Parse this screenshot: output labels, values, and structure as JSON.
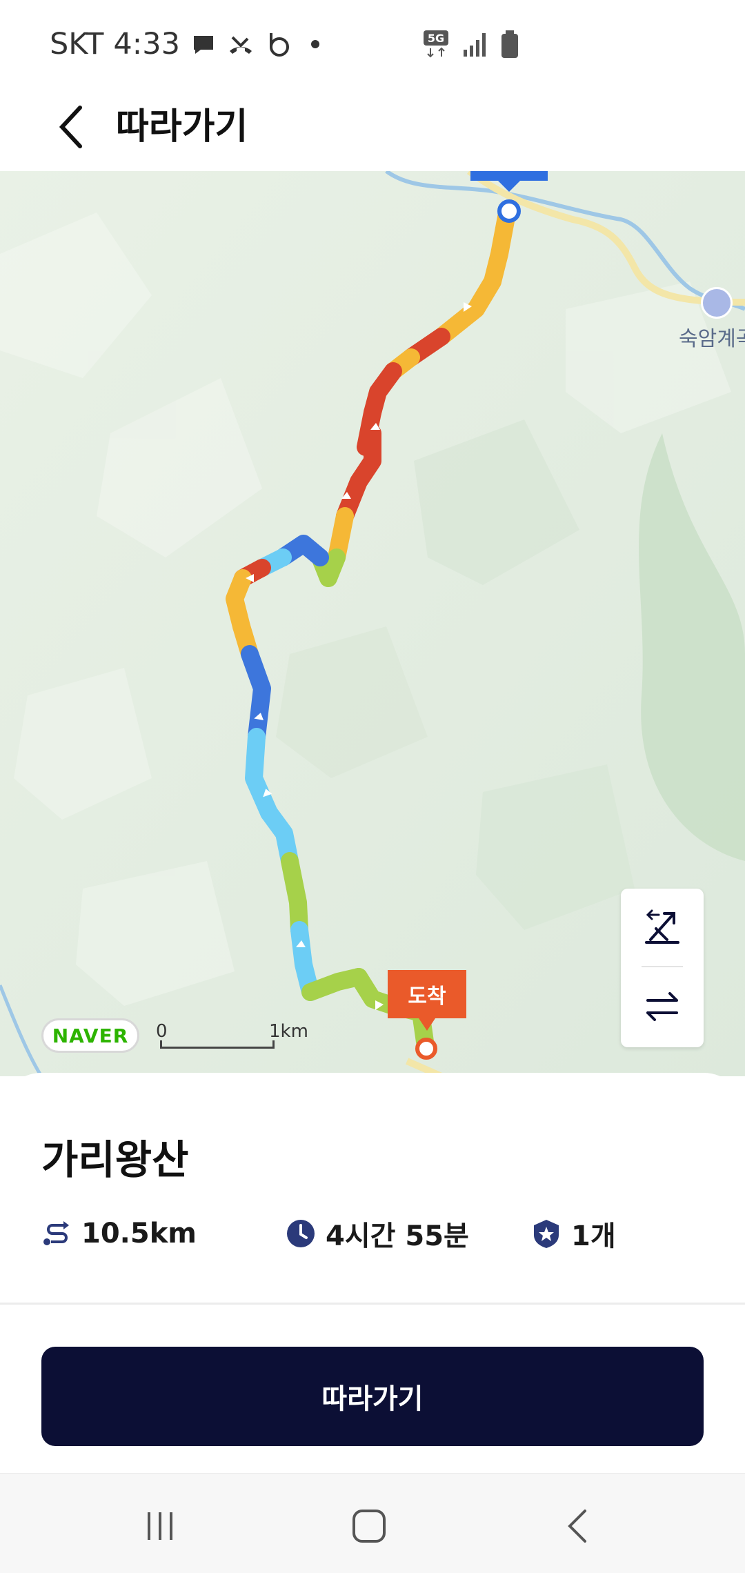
{
  "status_bar": {
    "carrier": "SKT",
    "time": "4:33",
    "network": "5G",
    "icons": [
      "chat-icon",
      "missed-call-icon",
      "b-app-icon",
      "dot-icon",
      "5g-icon",
      "signal-icon",
      "battery-icon"
    ]
  },
  "header": {
    "title": "따라가기",
    "back_icon": "chevron-left-icon"
  },
  "map": {
    "poi_label": "숙암계곡",
    "arrival_label": "도착",
    "naver_logo": "NAVER",
    "scale_zero": "0",
    "scale_distance": "1km",
    "controls": [
      "altitude-icon",
      "swap-direction-icon"
    ],
    "route_colors": {
      "steep": "#d9442c",
      "moderate": "#f5b836",
      "gentle": "#a6d14a",
      "descent": "#6ccdf5",
      "steep_descent": "#3d76dc"
    },
    "start_marker_color": "#2f6fe0",
    "end_marker_color": "#ea5a2a"
  },
  "course": {
    "name": "가리왕산",
    "distance": "10.5km",
    "duration": "4시간 55분",
    "badge_count": "1개",
    "stat_icons": [
      "route-icon",
      "clock-icon",
      "badge-star-icon"
    ]
  },
  "actions": {
    "follow_label": "따라가기"
  },
  "nav_bar": {
    "buttons": [
      "recents-icon",
      "home-icon",
      "back-icon"
    ]
  },
  "colors": {
    "primary_button": "#0c0f35",
    "icon_navy": "#2b3a7a"
  }
}
